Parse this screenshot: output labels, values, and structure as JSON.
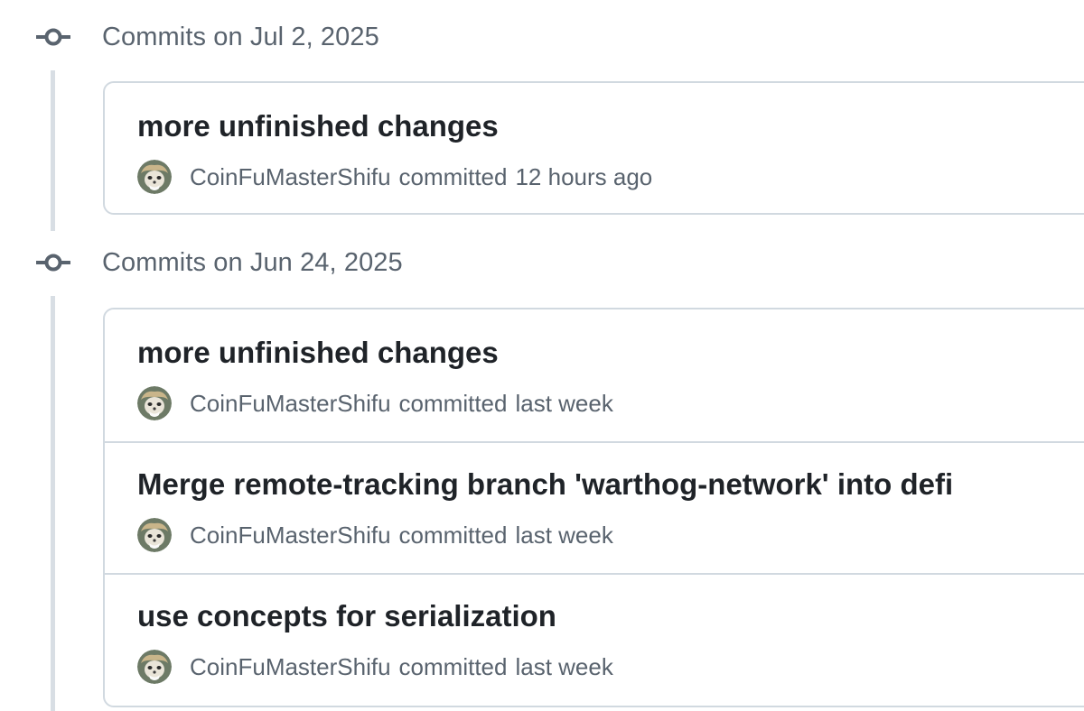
{
  "groups": [
    {
      "label": "Commits on Jul 2, 2025",
      "commits": [
        {
          "title": "more unfinished changes",
          "author": "CoinFuMasterShifu",
          "verb": "committed",
          "time": "12 hours ago"
        }
      ]
    },
    {
      "label": "Commits on Jun 24, 2025",
      "commits": [
        {
          "title": "more unfinished changes",
          "author": "CoinFuMasterShifu",
          "verb": "committed",
          "time": "last week"
        },
        {
          "title": "Merge remote-tracking branch 'warthog-network' into defi",
          "author": "CoinFuMasterShifu",
          "verb": "committed",
          "time": "last week"
        },
        {
          "title": "use concepts for serialization",
          "author": "CoinFuMasterShifu",
          "verb": "committed",
          "time": "last week"
        }
      ]
    }
  ],
  "icons": {
    "group_marker": "git-commit-icon",
    "avatar": "user-avatar"
  },
  "colors": {
    "muted_text": "#59636e",
    "title_text": "#1f2328",
    "border": "#d1d9e0",
    "timeline": "#d8dee4"
  }
}
